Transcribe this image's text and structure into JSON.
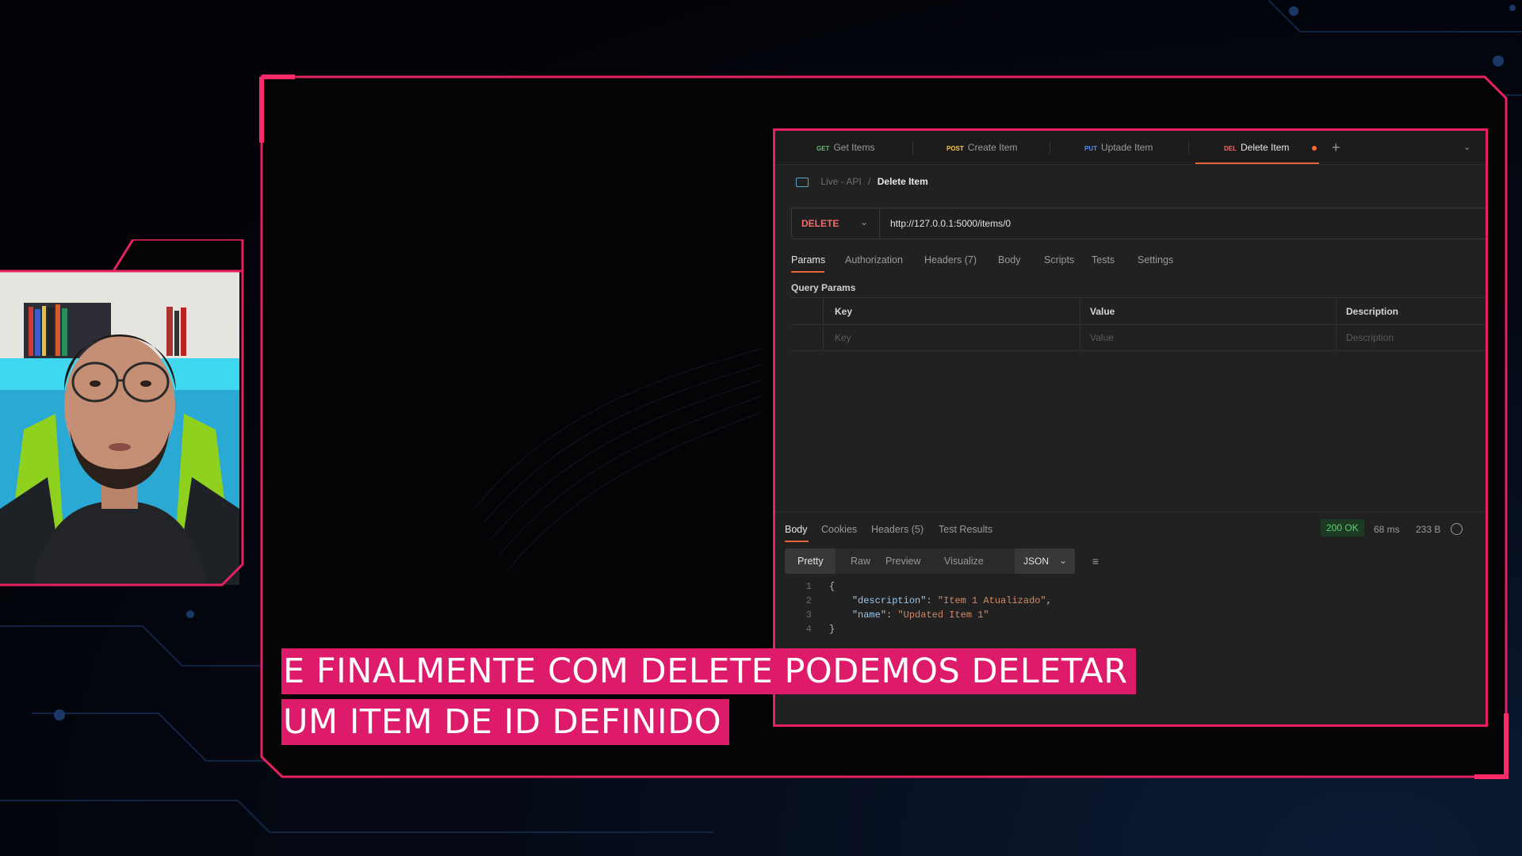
{
  "postman": {
    "tabs": [
      {
        "method": "GET",
        "label": "Get Items",
        "color": "#66bb6a"
      },
      {
        "method": "POST",
        "label": "Create Item",
        "color": "#f2c94c"
      },
      {
        "method": "PUT",
        "label": "Uptade Item",
        "color": "#5b8def"
      },
      {
        "method": "DEL",
        "label": "Delete Item",
        "color": "#f16b6b",
        "active": true
      }
    ],
    "breadcrumb": {
      "collection": "Live - API",
      "separator": "/",
      "request": "Delete Item"
    },
    "request": {
      "method": "DELETE",
      "url": "http://127.0.0.1:5000/items/0"
    },
    "request_tabs": [
      "Params",
      "Authorization",
      "Headers (7)",
      "Body",
      "Scripts",
      "Tests",
      "Settings"
    ],
    "query_params": {
      "title": "Query Params",
      "headers": [
        "Key",
        "Value",
        "Description"
      ],
      "placeholders": [
        "Key",
        "Value",
        "Description"
      ]
    },
    "response_tabs": [
      "Body",
      "Cookies",
      "Headers (5)",
      "Test Results"
    ],
    "response_meta": {
      "status": "200 OK",
      "time": "68 ms",
      "size": "233 B"
    },
    "format_tabs": [
      "Pretty",
      "Raw",
      "Preview",
      "Visualize"
    ],
    "format": "JSON",
    "code": {
      "line_numbers": [
        "1",
        "2",
        "3",
        "4"
      ],
      "open": "{",
      "key1": "\"description\"",
      "val1": "\"Item 1 Atualizado\"",
      "key2": "\"name\"",
      "val2": "\"Updated Item 1\"",
      "close": "}"
    }
  },
  "subtitle": {
    "line1": "E FINALMENTE COM DELETE PODEMOS DELETAR",
    "line2": "UM ITEM DE ID DEFINIDO"
  },
  "colors": {
    "frame": "#e7215f",
    "subtitle_bg": "#de1a6a",
    "status_ok": "#5fd071",
    "accent": "#e8643a"
  }
}
